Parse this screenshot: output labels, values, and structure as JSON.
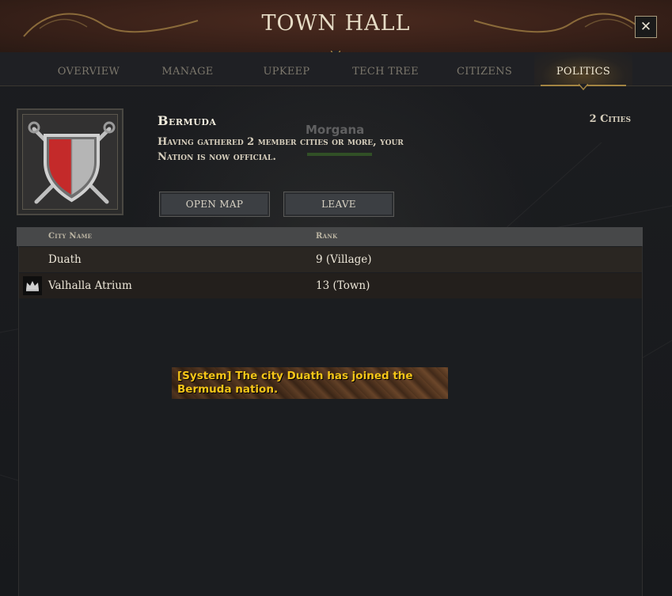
{
  "window": {
    "title": "TOWN HALL",
    "close_label": "✕"
  },
  "tabs": [
    {
      "label": "OVERVIEW",
      "active": false
    },
    {
      "label": "MANAGE",
      "active": false
    },
    {
      "label": "UPKEEP",
      "active": false
    },
    {
      "label": "TECH TREE",
      "active": false
    },
    {
      "label": "CITIZENS",
      "active": false
    },
    {
      "label": "POLITICS",
      "active": true
    }
  ],
  "nation": {
    "name": "Bermuda",
    "description": "Having gathered 2 member cities or more, your Nation is now official.",
    "cities_count": "2 Cities",
    "emblem_icon": "shield-crossed-swords-icon"
  },
  "background": {
    "player_name": "Morgana"
  },
  "buttons": {
    "open_map": "OPEN MAP",
    "leave": "LEAVE"
  },
  "table": {
    "headers": {
      "city_name": "City Name",
      "rank": "Rank"
    },
    "rows": [
      {
        "city": "Duath",
        "rank": "9 (Village)",
        "capital": false
      },
      {
        "city": "Valhalla Atrium",
        "rank": "13 (Town)",
        "capital": true,
        "icon": "crown-icon"
      }
    ]
  },
  "system_message": {
    "text": "[System] The city Duath has joined the Bermuda nation."
  },
  "colors": {
    "accent_gold": "#a38442",
    "system_text": "#f5c518",
    "header_bg": "#3a2119"
  }
}
